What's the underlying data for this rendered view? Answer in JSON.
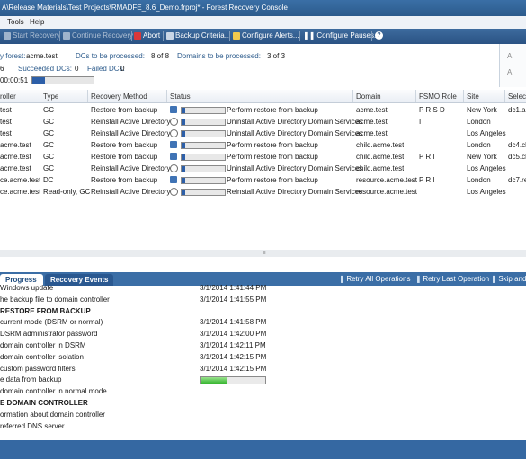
{
  "title": "A\\Release Materials\\Test Projects\\RMADFE_8.6_Demo.frproj* - Forest Recovery Console",
  "menu": [
    "Tools",
    "Help"
  ],
  "toolbar": {
    "start": "Start Recovery",
    "continue": "Continue Recovery",
    "abort": "Abort",
    "backup": "Backup Criteria...",
    "alerts": "Configure Alerts...",
    "pauses": "Configure Pauses..."
  },
  "summary": {
    "forest_label": "y forest:",
    "forest_value": "acme.test",
    "dcs_processed_label": "DCs to be processed:",
    "dcs_processed_value": "8 of 8",
    "domains_label": "Domains to be processed:",
    "domains_value": "3 of 3",
    "count_prefix": "6",
    "succeeded_label": "Succeeded DCs:",
    "succeeded_value": "0",
    "failed_label": "Failed DCs:",
    "failed_value": "0",
    "elapsed": "00:00:51"
  },
  "right_panel": [
    "A",
    "A"
  ],
  "grid": {
    "columns": [
      "roller",
      "Type",
      "Recovery Method",
      "Status",
      "Domain",
      "FSMO Role",
      "Site",
      "Select"
    ],
    "rows": [
      {
        "dc": "test",
        "type": "GC",
        "method": "Restore from backup",
        "clock": false,
        "progress": 0.08,
        "status": "Perform restore from backup",
        "domain": "acme.test",
        "fsmo": "P R   S D",
        "site": "New York",
        "select": "dc1.ac"
      },
      {
        "dc": "test",
        "type": "GC",
        "method": "Reinstall Active Directory",
        "clock": true,
        "progress": 0.08,
        "status": "Uninstall Active Directory Domain Services",
        "domain": "acme.test",
        "fsmo": "I",
        "site": "London",
        "select": ""
      },
      {
        "dc": "test",
        "type": "GC",
        "method": "Reinstall Active Directory",
        "clock": true,
        "progress": 0.08,
        "status": "Uninstall Active Directory Domain Services",
        "domain": "acme.test",
        "fsmo": "",
        "site": "Los Angeles",
        "select": ""
      },
      {
        "dc": "acme.test",
        "type": "GC",
        "method": "Restore from backup",
        "clock": false,
        "progress": 0.08,
        "status": "Perform restore from backup",
        "domain": "child.acme.test",
        "fsmo": "",
        "site": "London",
        "select": "dc4.ch"
      },
      {
        "dc": "acme.test",
        "type": "GC",
        "method": "Restore from backup",
        "clock": false,
        "progress": 0.08,
        "status": "Perform restore from backup",
        "domain": "child.acme.test",
        "fsmo": "P R I",
        "site": "New York",
        "select": "dc5.ch"
      },
      {
        "dc": "acme.test",
        "type": "GC",
        "method": "Reinstall Active Directory",
        "clock": true,
        "progress": 0.08,
        "status": "Uninstall Active Directory Domain Services",
        "domain": "child.acme.test",
        "fsmo": "",
        "site": "Los Angeles",
        "select": ""
      },
      {
        "dc": "ce.acme.test",
        "type": "DC",
        "method": "Restore from backup",
        "clock": false,
        "progress": 0.08,
        "status": "Perform restore from backup",
        "domain": "resource.acme.test",
        "fsmo": "P R I",
        "site": "London",
        "select": "dc7.re"
      },
      {
        "dc": "ce.acme.test",
        "type": "Read-only, GC",
        "method": "Reinstall Active Directory",
        "clock": true,
        "progress": 0.08,
        "status": "Reinstall Active Directory Domain Services",
        "domain": "resource.acme.test",
        "fsmo": "",
        "site": "Los Angeles",
        "select": ""
      }
    ]
  },
  "tabs": [
    "Progress",
    "Recovery Events"
  ],
  "tab_actions": [
    "Retry All Operations",
    "Retry Last Operation",
    "Skip and"
  ],
  "progress_items": [
    {
      "label": "Windows update",
      "time": "3/1/2014 1:41:44 PM",
      "heading": false
    },
    {
      "label": "he backup file to domain controller",
      "time": "3/1/2014 1:41:55 PM",
      "heading": false
    },
    {
      "label": "RESTORE FROM BACKUP",
      "time": "",
      "heading": true
    },
    {
      "label": "current mode (DSRM or normal)",
      "time": "3/1/2014 1:41:58 PM",
      "heading": false
    },
    {
      "label": "DSRM administrator password",
      "time": "3/1/2014 1:42:00 PM",
      "heading": false
    },
    {
      "label": "domain controller in DSRM",
      "time": "3/1/2014 1:42:11 PM",
      "heading": false
    },
    {
      "label": "domain controller isolation",
      "time": "3/1/2014 1:42:15 PM",
      "heading": false
    },
    {
      "label": "custom password filters",
      "time": "3/1/2014 1:42:15 PM",
      "heading": false
    },
    {
      "label": "e data from backup",
      "time": "",
      "heading": false,
      "progress": 0.42
    },
    {
      "label": "domain controller in normal mode",
      "time": "",
      "heading": false
    },
    {
      "label": "E DOMAIN CONTROLLER",
      "time": "",
      "heading": true
    },
    {
      "label": "ormation about domain controller",
      "time": "",
      "heading": false
    },
    {
      "label": "referred DNS server",
      "time": "",
      "heading": false
    }
  ],
  "colors": {
    "accent": "#2b5a8b",
    "bar": "#2d5fa8",
    "progress_green": "#36b52f"
  }
}
